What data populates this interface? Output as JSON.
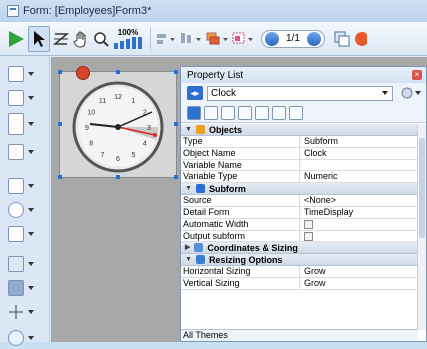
{
  "window": {
    "title": "Form: [Employees]Form3*"
  },
  "toolbar": {
    "zoom_label": "100%",
    "page": "1/1"
  },
  "panel": {
    "title": "Property List",
    "selected_object": "Clock",
    "sections": [
      {
        "label": "Objects",
        "expanded": true,
        "rows": [
          {
            "key": "Type",
            "value": "Subform"
          },
          {
            "key": "Object Name",
            "value": "Clock"
          },
          {
            "key": "Variable Name",
            "value": ""
          },
          {
            "key": "Variable Type",
            "value": "Numeric"
          }
        ]
      },
      {
        "label": "Subform",
        "expanded": true,
        "rows": [
          {
            "key": "Source",
            "value": "<None>"
          },
          {
            "key": "Detail Form",
            "value": "TimeDisplay"
          },
          {
            "key": "Automatic Width",
            "value": "checkbox-unchecked"
          },
          {
            "key": "Output subform",
            "value": "checkbox-unchecked"
          }
        ]
      },
      {
        "label": "Coordinates & Sizing",
        "expanded": false,
        "rows": []
      },
      {
        "label": "Resizing Options",
        "expanded": true,
        "rows": [
          {
            "key": "Horizontal Sizing",
            "value": "Grow"
          },
          {
            "key": "Vertical Sizing",
            "value": "Grow"
          }
        ]
      }
    ],
    "themes_label": "All Themes"
  },
  "clock": {
    "numbers": [
      "12",
      "1",
      "2",
      "3",
      "4",
      "5",
      "6",
      "7",
      "8",
      "9",
      "10",
      "11"
    ]
  },
  "colors": {
    "accent": "#2e6fd0",
    "close": "#d9534f",
    "play": "#2ea43a"
  }
}
